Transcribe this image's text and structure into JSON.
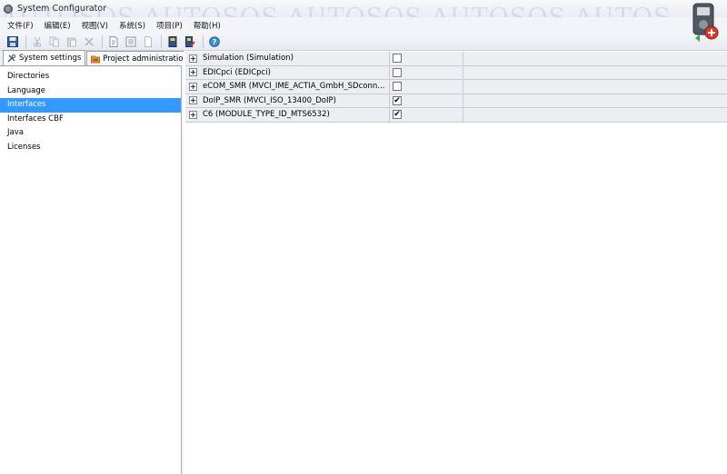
{
  "window": {
    "title": "System Configurator"
  },
  "watermark": "AUTOSOS AUTOSOS AUTOSOS AUTOSOS AUTOS",
  "menu": [
    {
      "label": "文件(F)"
    },
    {
      "label": "编辑(E)"
    },
    {
      "label": "视图(V)"
    },
    {
      "label": "系统(S)"
    },
    {
      "label": "项目(P)"
    },
    {
      "label": "帮助(H)"
    }
  ],
  "toolbar": {
    "icons": [
      "save-icon",
      "cut-icon",
      "copy-icon",
      "paste-icon",
      "delete-icon",
      "new-document-icon",
      "properties-icon",
      "document-icon",
      "book-icon",
      "book-edit-icon",
      "help-icon"
    ]
  },
  "left": {
    "tabs": [
      {
        "label": "System settings",
        "icon": "tools-icon"
      },
      {
        "label": "Project administration",
        "icon": "folder-icon"
      }
    ],
    "items": [
      {
        "label": "Directories"
      },
      {
        "label": "Language"
      },
      {
        "label": "Interfaces",
        "selected": true
      },
      {
        "label": "Interfaces CBF"
      },
      {
        "label": "Java"
      },
      {
        "label": "Licenses"
      }
    ]
  },
  "interfaces": [
    {
      "label": "Simulation (Simulation)",
      "checked": false
    },
    {
      "label": "EDICpci (EDICpci)",
      "checked": false
    },
    {
      "label": "eCOM_SMR (MVCI_IME_ACTIA_GmbH_SDconn...",
      "checked": false
    },
    {
      "label": "DoIP_SMR (MVCI_ISO_13400_DoIP)",
      "checked": true
    },
    {
      "label": "C6 (MODULE_TYPE_ID_MTS6532)",
      "checked": true
    }
  ],
  "colors": {
    "selection": "#3399ff",
    "row_bg": "#eceef2"
  }
}
